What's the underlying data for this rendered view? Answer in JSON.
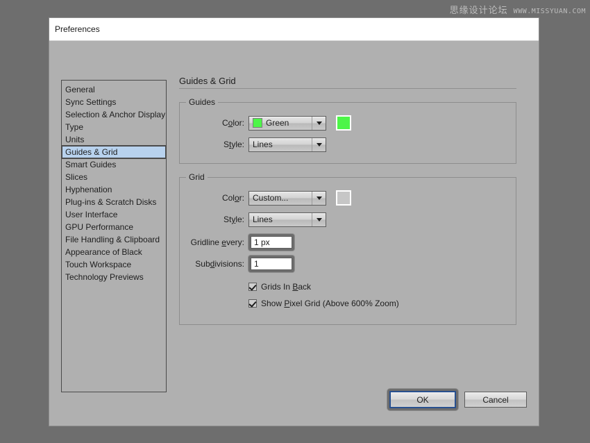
{
  "watermark": {
    "cn_text": "思缘设计论坛",
    "url_text": "WWW.MISSYUAN.COM"
  },
  "dialog": {
    "title": "Preferences"
  },
  "sidebar": {
    "items": [
      {
        "label": "General",
        "selected": false
      },
      {
        "label": "Sync Settings",
        "selected": false
      },
      {
        "label": "Selection & Anchor Display",
        "selected": false
      },
      {
        "label": "Type",
        "selected": false
      },
      {
        "label": "Units",
        "selected": false
      },
      {
        "label": "Guides & Grid",
        "selected": true
      },
      {
        "label": "Smart Guides",
        "selected": false
      },
      {
        "label": "Slices",
        "selected": false
      },
      {
        "label": "Hyphenation",
        "selected": false
      },
      {
        "label": "Plug-ins & Scratch Disks",
        "selected": false
      },
      {
        "label": "User Interface",
        "selected": false
      },
      {
        "label": "GPU Performance",
        "selected": false
      },
      {
        "label": "File Handling & Clipboard",
        "selected": false
      },
      {
        "label": "Appearance of Black",
        "selected": false
      },
      {
        "label": "Touch Workspace",
        "selected": false
      },
      {
        "label": "Technology Previews",
        "selected": false
      }
    ]
  },
  "pane": {
    "heading": "Guides & Grid",
    "guides": {
      "title": "Guides",
      "color_label_pre": "C",
      "color_label_acc": "o",
      "color_label_post": "lor:",
      "color_value": "Green",
      "color_swatch_hex": "#4df548",
      "color_chip_hex": "#4df548",
      "style_label_pre": "S",
      "style_label_acc": "t",
      "style_label_post": "yle:",
      "style_value": "Lines"
    },
    "grid": {
      "title": "Grid",
      "color_label_pre": "Col",
      "color_label_acc": "o",
      "color_label_post": "r:",
      "color_value": "Custom...",
      "color_chip_hex": "#c6c6c6",
      "style_label_pre": "St",
      "style_label_acc": "y",
      "style_label_post": "le:",
      "style_value": "Lines",
      "gridline_label_pre": "Gridline ",
      "gridline_label_acc": "e",
      "gridline_label_post": "very:",
      "gridline_value": "1 px",
      "subdivisions_label_pre": "Sub",
      "subdivisions_label_acc": "d",
      "subdivisions_label_post": "ivisions:",
      "subdivisions_value": "1",
      "grids_in_back": {
        "pre": "Grids In ",
        "acc": "B",
        "post": "ack",
        "checked": true
      },
      "show_pixel_grid": {
        "pre": "Show ",
        "acc": "P",
        "post": "ixel Grid (Above 600% Zoom)",
        "checked": true
      }
    }
  },
  "footer": {
    "ok_label": "OK",
    "cancel_label": "Cancel"
  }
}
